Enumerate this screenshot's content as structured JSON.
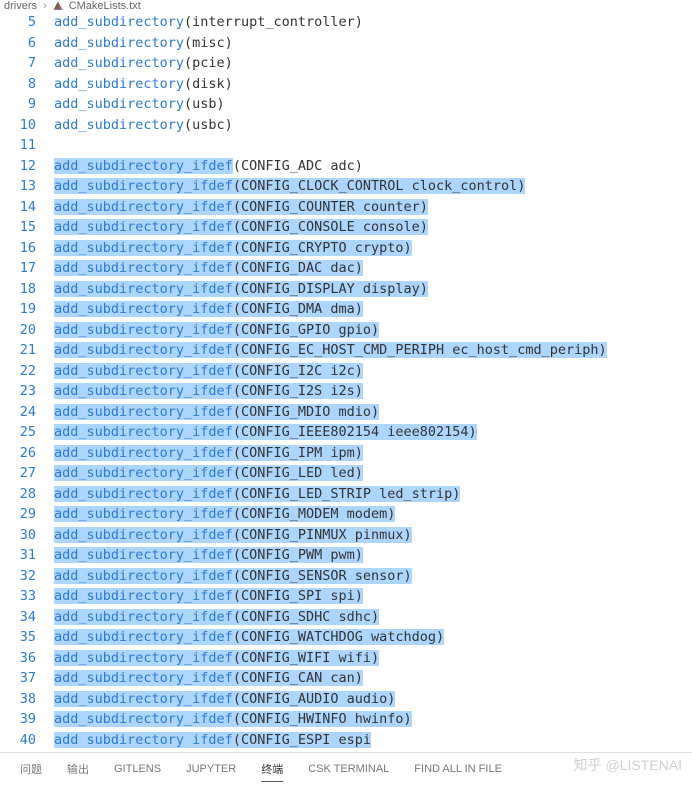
{
  "breadcrumb": {
    "folder": "drivers",
    "separator": "›",
    "file": "CMakeLists.txt"
  },
  "lines": [
    {
      "num": 5,
      "fn": "add_subdirectory",
      "args": "interrupt_controller",
      "sel": false
    },
    {
      "num": 6,
      "fn": "add_subdirectory",
      "args": "misc",
      "sel": false
    },
    {
      "num": 7,
      "fn": "add_subdirectory",
      "args": "pcie",
      "sel": false
    },
    {
      "num": 8,
      "fn": "add_subdirectory",
      "args": "disk",
      "sel": false
    },
    {
      "num": 9,
      "fn": "add_subdirectory",
      "args": "usb",
      "sel": false
    },
    {
      "num": 10,
      "fn": "add_subdirectory",
      "args": "usbc",
      "sel": false
    },
    {
      "num": 11,
      "fn": "",
      "args": "",
      "sel": false,
      "blank": true
    },
    {
      "num": 12,
      "fn": "add_subdirectory_ifdef",
      "args": "CONFIG_ADC adc",
      "sel": true,
      "first": true
    },
    {
      "num": 13,
      "fn": "add_subdirectory_ifdef",
      "args": "CONFIG_CLOCK_CONTROL clock_control",
      "sel": true
    },
    {
      "num": 14,
      "fn": "add_subdirectory_ifdef",
      "args": "CONFIG_COUNTER counter",
      "sel": true
    },
    {
      "num": 15,
      "fn": "add_subdirectory_ifdef",
      "args": "CONFIG_CONSOLE console",
      "sel": true,
      "caret": true
    },
    {
      "num": 16,
      "fn": "add_subdirectory_ifdef",
      "args": "CONFIG_CRYPTO crypto",
      "sel": true
    },
    {
      "num": 17,
      "fn": "add_subdirectory_ifdef",
      "args": "CONFIG_DAC dac",
      "sel": true
    },
    {
      "num": 18,
      "fn": "add_subdirectory_ifdef",
      "args": "CONFIG_DISPLAY display",
      "sel": true
    },
    {
      "num": 19,
      "fn": "add_subdirectory_ifdef",
      "args": "CONFIG_DMA dma",
      "sel": true
    },
    {
      "num": 20,
      "fn": "add_subdirectory_ifdef",
      "args": "CONFIG_GPIO gpio",
      "sel": true
    },
    {
      "num": 21,
      "fn": "add_subdirectory_ifdef",
      "args": "CONFIG_EC_HOST_CMD_PERIPH ec_host_cmd_periph",
      "sel": true
    },
    {
      "num": 22,
      "fn": "add_subdirectory_ifdef",
      "args": "CONFIG_I2C i2c",
      "sel": true
    },
    {
      "num": 23,
      "fn": "add_subdirectory_ifdef",
      "args": "CONFIG_I2S i2s",
      "sel": true
    },
    {
      "num": 24,
      "fn": "add_subdirectory_ifdef",
      "args": "CONFIG_MDIO mdio",
      "sel": true
    },
    {
      "num": 25,
      "fn": "add_subdirectory_ifdef",
      "args": "CONFIG_IEEE802154 ieee802154",
      "sel": true
    },
    {
      "num": 26,
      "fn": "add_subdirectory_ifdef",
      "args": "CONFIG_IPM ipm",
      "sel": true
    },
    {
      "num": 27,
      "fn": "add_subdirectory_ifdef",
      "args": "CONFIG_LED led",
      "sel": true
    },
    {
      "num": 28,
      "fn": "add_subdirectory_ifdef",
      "args": "CONFIG_LED_STRIP led_strip",
      "sel": true
    },
    {
      "num": 29,
      "fn": "add_subdirectory_ifdef",
      "args": "CONFIG_MODEM modem",
      "sel": true
    },
    {
      "num": 30,
      "fn": "add_subdirectory_ifdef",
      "args": "CONFIG_PINMUX pinmux",
      "sel": true
    },
    {
      "num": 31,
      "fn": "add_subdirectory_ifdef",
      "args": "CONFIG_PWM pwm",
      "sel": true
    },
    {
      "num": 32,
      "fn": "add_subdirectory_ifdef",
      "args": "CONFIG_SENSOR sensor",
      "sel": true
    },
    {
      "num": 33,
      "fn": "add_subdirectory_ifdef",
      "args": "CONFIG_SPI spi",
      "sel": true
    },
    {
      "num": 34,
      "fn": "add_subdirectory_ifdef",
      "args": "CONFIG_SDHC sdhc",
      "sel": true
    },
    {
      "num": 35,
      "fn": "add_subdirectory_ifdef",
      "args": "CONFIG_WATCHDOG watchdog",
      "sel": true
    },
    {
      "num": 36,
      "fn": "add_subdirectory_ifdef",
      "args": "CONFIG_WIFI wifi",
      "sel": true
    },
    {
      "num": 37,
      "fn": "add_subdirectory_ifdef",
      "args": "CONFIG_CAN can",
      "sel": true
    },
    {
      "num": 38,
      "fn": "add_subdirectory_ifdef",
      "args": "CONFIG_AUDIO audio",
      "sel": true
    },
    {
      "num": 39,
      "fn": "add_subdirectory_ifdef",
      "args": "CONFIG_HWINFO hwinfo",
      "sel": true
    },
    {
      "num": 40,
      "fn": "add_subdirectory_ifdef",
      "args": "CONFIG_ESPI espi",
      "sel": true,
      "last": true
    }
  ],
  "panel_tabs": [
    {
      "label": "问题",
      "active": false
    },
    {
      "label": "输出",
      "active": false
    },
    {
      "label": "GITLENS",
      "active": false
    },
    {
      "label": "JUPYTER",
      "active": false
    },
    {
      "label": "终端",
      "active": true
    },
    {
      "label": "CSK TERMINAL",
      "active": false
    },
    {
      "label": "FIND ALL IN FILE",
      "active": false
    }
  ],
  "watermark": "知乎 @LISTENAI"
}
